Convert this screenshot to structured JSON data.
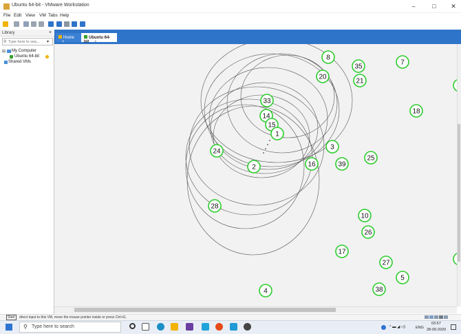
{
  "window": {
    "title": "Ubuntu 64-bit - VMware Workstation",
    "minimize": "–",
    "maximize": "□",
    "close": "✕"
  },
  "menu": [
    "File",
    "Edit",
    "View",
    "VM",
    "Tabs",
    "Help"
  ],
  "library": {
    "title": "Library",
    "close": "×",
    "search_placeholder": "Type here to sea...",
    "tree": [
      "My Computer",
      "Ubuntu 64-bit",
      "Shared VMs"
    ]
  },
  "tabs": [
    {
      "label": "Home",
      "close": "×"
    },
    {
      "label": "Ubuntu 64-bit",
      "close": "×"
    }
  ],
  "status": {
    "start_label": "Start",
    "message": "direct input to this VM, move the mouse pointer inside or press Ctrl+G."
  },
  "taskbar": {
    "search_placeholder": "Type here to search",
    "language": "ENG",
    "time": "03:57",
    "date": "28-09-2020"
  },
  "nodes": [
    {
      "id": "8"
    },
    {
      "id": "35"
    },
    {
      "id": "7"
    },
    {
      "id": "20"
    },
    {
      "id": "21"
    },
    {
      "id": "33"
    },
    {
      "id": "14"
    },
    {
      "id": "15"
    },
    {
      "id": "1"
    },
    {
      "id": "18"
    },
    {
      "id": "24"
    },
    {
      "id": "3"
    },
    {
      "id": "25"
    },
    {
      "id": "2"
    },
    {
      "id": "16"
    },
    {
      "id": "39"
    },
    {
      "id": "28"
    },
    {
      "id": "10"
    },
    {
      "id": "26"
    },
    {
      "id": "17"
    },
    {
      "id": "27"
    },
    {
      "id": "5"
    },
    {
      "id": "4"
    },
    {
      "id": "38"
    }
  ],
  "node_color": "#2ecc2e",
  "tab_accent": "#2e74c9"
}
